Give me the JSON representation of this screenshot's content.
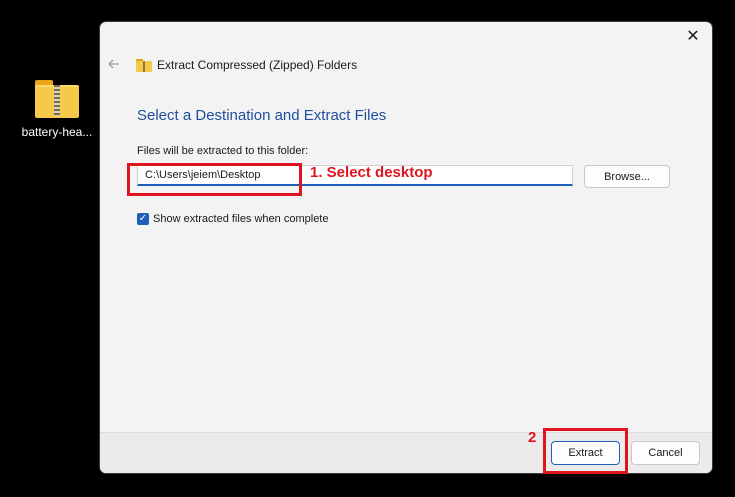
{
  "desktop": {
    "icon_name": "zipped-folder-icon",
    "file_label": "battery-hea..."
  },
  "dialog": {
    "title": "Extract Compressed (Zipped) Folders",
    "close_glyph": "✕",
    "heading": "Select a Destination and Extract Files",
    "field_label": "Files will be extracted to this folder:",
    "path_value": "C:\\Users\\jeiem\\Desktop",
    "browse_label": "Browse...",
    "show_files_label": "Show extracted files when complete",
    "show_files_checked": true,
    "extract_label": "Extract",
    "cancel_label": "Cancel"
  },
  "annotations": {
    "step1_text": "1. Select desktop",
    "step2_text": "2",
    "color": "#e0141e"
  },
  "colors": {
    "accent": "#1f5fb8",
    "heading": "#1f4e9c",
    "folder": "#f7c948"
  }
}
